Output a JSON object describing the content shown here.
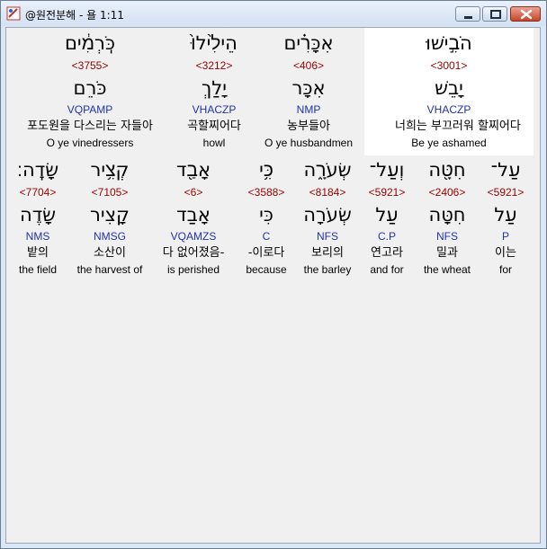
{
  "window": {
    "title": "@원전분해 - 욜 1:11"
  },
  "colors": {
    "strong": "#990000",
    "parse": "#2233aa",
    "highlight": "#ffffff"
  },
  "verse": {
    "row1": [
      {
        "heb": "הֹבִ֣ישׁוּ",
        "strong": "<3001>",
        "root": "יָבֵשׁ",
        "parse": "VHACZP",
        "kor": "너희는 부끄러워 할찌어다",
        "eng": "Be ye ashamed"
      },
      {
        "heb": "אִכָּרִ֗ים",
        "strong": "<406>",
        "root": "אִכָּר",
        "parse": "NMP",
        "kor": "농부들아",
        "eng": "O ye husbandmen"
      },
      {
        "heb": "הֵילִ֙ילוּ֙",
        "strong": "<3212>",
        "root": "יָלַךְ",
        "parse": "VHACZP",
        "kor": "곡할찌어다",
        "eng": "howl"
      },
      {
        "heb": "כֹּֽרְמִ֔ים",
        "strong": "<3755>",
        "root": "כֹּרֵם",
        "parse": "VQPAMP",
        "kor": "포도원을 다스리는 자들아",
        "eng": "O ye vinedressers"
      }
    ],
    "row2": [
      {
        "heb": "עַל־",
        "strong": "<5921>",
        "root": "עַל",
        "parse": "P",
        "kor": "이는",
        "eng": "for"
      },
      {
        "heb": "חִטָּ֖ה",
        "strong": "<2406>",
        "root": "חִטָּה",
        "parse": "NFS",
        "kor": "밀과",
        "eng": "the wheat"
      },
      {
        "heb": "וְעַל־",
        "strong": "<5921>",
        "root": "עַל",
        "parse": "C.P",
        "kor": "연고라",
        "eng": "and for"
      },
      {
        "heb": "שְׂעֹרָ֑ה",
        "strong": "<8184>",
        "root": "שְׂעֹרָה",
        "parse": "NFS",
        "kor": "보리의",
        "eng": "the barley"
      },
      {
        "heb": "כִּ֥י",
        "strong": "<3588>",
        "root": "כִּי",
        "parse": "C",
        "kor": "-이로다",
        "eng": "because"
      },
      {
        "heb": "אָבַ֖ד",
        "strong": "<6>",
        "root": "אָבַד",
        "parse": "VQAMZS",
        "kor": "다 없어졌음-",
        "eng": "is perished"
      },
      {
        "heb": "קְצִ֥יר",
        "strong": "<7105>",
        "root": "קָצִיר",
        "parse": "NMSG",
        "kor": "소산이",
        "eng": "the harvest of"
      },
      {
        "heb": "שָׂדֶֽה׃",
        "strong": "<7704>",
        "root": "שָׂדֶה",
        "parse": "NMS",
        "kor": "밭의",
        "eng": "the field"
      }
    ]
  }
}
